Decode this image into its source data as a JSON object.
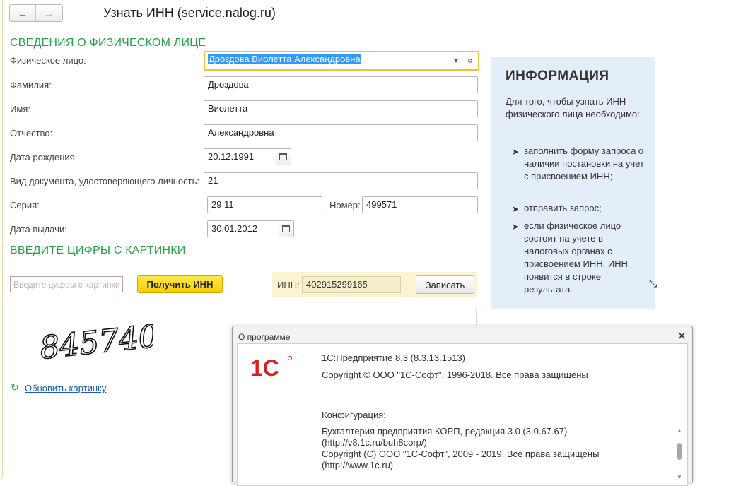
{
  "header": {
    "title": "Узнать ИНН (service.nalog.ru)",
    "back_icon": "←",
    "forward_icon": "→"
  },
  "person_section": {
    "title": "СВЕДЕНИЯ О ФИЗИЧЕСКОМ ЛИЦЕ",
    "person_label": "Физическое лицо:",
    "person_value": "Дроздова Виолетта Александровна",
    "lastname_label": "Фамилия:",
    "lastname_value": "Дроздова",
    "firstname_label": "Имя:",
    "firstname_value": "Виолетта",
    "patronymic_label": "Отчество:",
    "patronymic_value": "Александровна",
    "birthdate_label": "Дата рождения:",
    "birthdate_value": "20.12.1991",
    "doctype_label": "Вид документа, удостоверяющего личность:",
    "doctype_value": "21",
    "series_label": "Серия:",
    "series_value": "29 11",
    "number_label": "Номер:",
    "number_value": "499571",
    "issue_label": "Дата выдачи:",
    "issue_value": "30.01.2012"
  },
  "captcha_section": {
    "title": "ВВЕДИТЕ ЦИФРЫ С КАРТИНКИ",
    "input_placeholder": "Введите цифры с картинки",
    "get_inn_button": "Получить ИНН",
    "inn_label": "ИНН:",
    "inn_value": "402915299165",
    "save_button": "Записать",
    "captcha_text": "845740",
    "refresh_link": "Обновить картинку"
  },
  "info_panel": {
    "title": "ИНФОРМАЦИЯ",
    "intro": "Для того, чтобы узнать ИНН физического лица необходимо:",
    "items": [
      "заполнить форму запроса о наличии постановки на учет с присвоением ИНН;",
      "отправить запрос;",
      "если физическое лицо состоит на учете в налоговых органах с присвоением ИНН, ИНН появится в строке результата."
    ]
  },
  "about_dialog": {
    "title": "О программе",
    "logo_text": "1С",
    "product": "1С:Предприятие 8.3 (8.3.13.1513)",
    "copyright": "Copyright © ООО \"1С-Софт\", 1996-2018. Все права защищены",
    "config_label": "Конфигурация:",
    "config_name": "Бухгалтерия предприятия КОРП, редакция 3.0 (3.0.67.67)",
    "config_url": "(http://v8.1c.ru/buh8corp/)",
    "config_copyright": "Copyright (C) ООО \"1С-Софт\", 2009 - 2019. Все права защищены",
    "config_site": "(http://www.1c.ru)"
  },
  "colors": {
    "section_green": "#27a04a",
    "accent_yellow": "#f5cf00",
    "info_bg": "#e4eef9",
    "selection_blue": "#3399ff",
    "logo_red": "#d3231e"
  }
}
